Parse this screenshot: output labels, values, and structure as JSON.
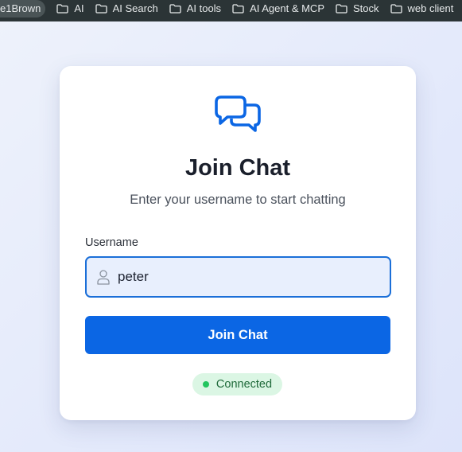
{
  "bookmarks": {
    "active_item": "e1Brown",
    "folders": [
      "AI",
      "AI Search",
      "AI tools",
      "AI Agent & MCP",
      "Stock",
      "web client"
    ]
  },
  "login": {
    "title": "Join Chat",
    "subtitle": "Enter your username to start chatting",
    "username_label": "Username",
    "username_value": "peter",
    "join_button_label": "Join Chat",
    "status_text": "Connected"
  },
  "colors": {
    "accent": "#0b66e4",
    "input_border": "#1b6fd8",
    "status_green": "#22c55e",
    "status_bg": "#dbf6e4"
  },
  "icons": {
    "folder": "folder-icon",
    "chat": "chat-bubbles-icon",
    "user": "user-icon",
    "status": "status-dot-icon"
  }
}
